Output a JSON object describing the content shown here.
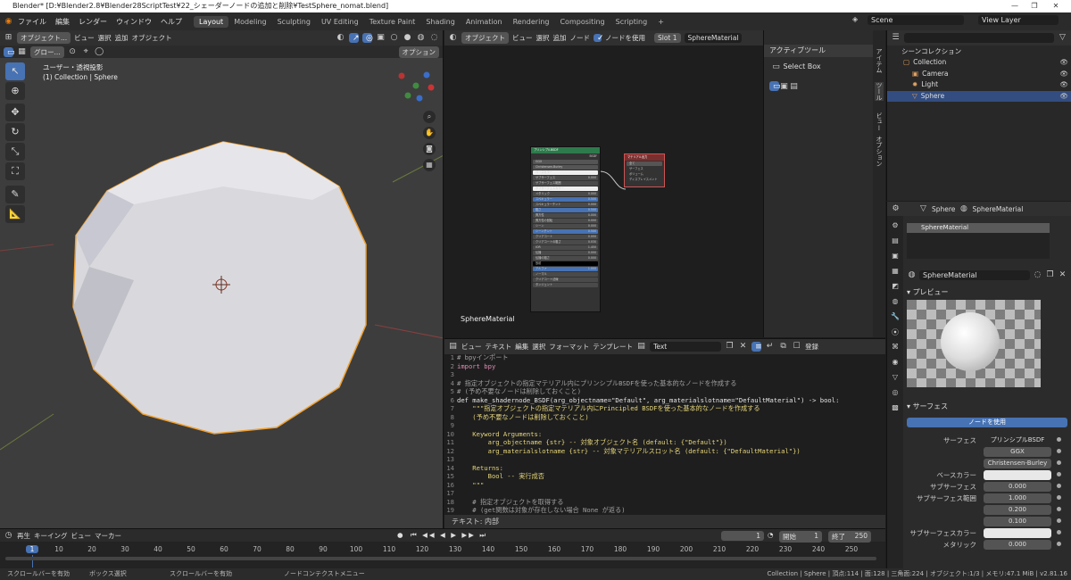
{
  "window": {
    "title": "Blender* [D:¥Blender2.8¥Blender28ScriptTest¥22_シェーダーノードの追加と削除¥TestSphere_nomat.blend]",
    "buttons": [
      "—",
      "❐",
      "✕"
    ]
  },
  "topbar": {
    "menus": [
      "ファイル",
      "編集",
      "レンダー",
      "ウィンドウ",
      "ヘルプ"
    ],
    "workspaces": [
      "Layout",
      "Modeling",
      "Sculpting",
      "UV Editing",
      "Texture Paint",
      "Shading",
      "Animation",
      "Rendering",
      "Compositing",
      "Scripting"
    ],
    "active_workspace": "Layout",
    "add_tab": "+",
    "scene": "Scene",
    "view_layer": "View Layer"
  },
  "viewport": {
    "mode": "オブジェクト...",
    "menus": [
      "ビュー",
      "選択",
      "追加",
      "オブジェクト"
    ],
    "transform": "グロー...",
    "options": "オプション",
    "overlay_line1": "ユーザー・透視投影",
    "overlay_line2": "(1) Collection | Sphere"
  },
  "node_editor": {
    "editor": "オブジェクト",
    "menus": [
      "ビュー",
      "選択",
      "追加",
      "ノード"
    ],
    "use_nodes": "ノードを使用",
    "slot": "Slot 1",
    "material": "SphereMaterial",
    "frame_label": "SphereMaterial",
    "bsdf": {
      "title": "プリンシプルBSDF",
      "out": "BSDF",
      "rows": [
        {
          "l": "GGX",
          "v": "",
          "k": "dd"
        },
        {
          "l": "Christensen-Burley",
          "v": "",
          "k": "dd"
        },
        {
          "l": "ベースカラー",
          "v": "",
          "k": "white"
        },
        {
          "l": "サブサーフェス",
          "v": "0.000",
          "k": ""
        },
        {
          "l": "サブサーフェス範囲",
          "v": "",
          "k": ""
        },
        {
          "l": "サブサーフェスカラー",
          "v": "",
          "k": "white"
        },
        {
          "l": "メタリック",
          "v": "0.000",
          "k": ""
        },
        {
          "l": "スペキュラー",
          "v": "0.500",
          "k": "blue"
        },
        {
          "l": "スペキュラーチント",
          "v": "0.000",
          "k": ""
        },
        {
          "l": "粗さ",
          "v": "0.500",
          "k": "blue"
        },
        {
          "l": "異方性",
          "v": "0.000",
          "k": ""
        },
        {
          "l": "異方性の回転",
          "v": "0.000",
          "k": ""
        },
        {
          "l": "シーン",
          "v": "0.000",
          "k": ""
        },
        {
          "l": "シーンチント",
          "v": "0.500",
          "k": "blue"
        },
        {
          "l": "クリアコート",
          "v": "0.000",
          "k": ""
        },
        {
          "l": "クリアコートの粗さ",
          "v": "0.030",
          "k": ""
        },
        {
          "l": "IOR",
          "v": "1.450",
          "k": ""
        },
        {
          "l": "伝播",
          "v": "0.000",
          "k": ""
        },
        {
          "l": "伝播の粗さ",
          "v": "0.000",
          "k": ""
        },
        {
          "l": "放射",
          "v": "",
          "k": "black"
        },
        {
          "l": "アルファ",
          "v": "1.000",
          "k": "blue"
        },
        {
          "l": "ノーマル",
          "v": "",
          "k": ""
        },
        {
          "l": "クリアコート法線",
          "v": "",
          "k": ""
        },
        {
          "l": "タンジェント",
          "v": "",
          "k": ""
        }
      ]
    },
    "output": {
      "title": "マテリアル出力",
      "dd": "全て",
      "rows": [
        "サーフェス",
        "ボリューム",
        "ディスプレイスメント"
      ]
    }
  },
  "npanel": {
    "title": "アクティブツール",
    "tool": "Select Box",
    "tabs": [
      "アイテム",
      "ツール",
      "ビュー",
      "オプション"
    ]
  },
  "text_editor": {
    "menus": [
      "ビュー",
      "テキスト",
      "編集",
      "選択",
      "フォーマット",
      "テンプレート"
    ],
    "file": "Text",
    "register": "登録",
    "footer": "テキスト: 内部",
    "lines": [
      {
        "n": "1",
        "t": "# bpyインポート",
        "c": "#a0a0a0"
      },
      {
        "n": "2",
        "t": "import bpy",
        "c": "#e08cb4"
      },
      {
        "n": "3",
        "t": "",
        "c": "#ddd"
      },
      {
        "n": "4",
        "t": "# 指定オブジェクトの指定マテリアル内にプリンシプルBSDFを使った基本的なノードを作成する",
        "c": "#a0a0a0"
      },
      {
        "n": "5",
        "t": "# (予め不要なノードは削除しておくこと)",
        "c": "#a0a0a0"
      },
      {
        "n": "6",
        "t": "def make_shadernode_BSDF(arg_objectname=\"Default\", arg_materialslotname=\"DefaultMaterial\") -> bool:",
        "c": "#e6e6e6"
      },
      {
        "n": "7",
        "t": "    \"\"\"指定オブジェクトの指定マテリアル内にPrincipled BSDFを使った基本的なノードを作成する",
        "c": "#e6d67a"
      },
      {
        "n": "8",
        "t": "    (予め不要なノードは削除しておくこと)",
        "c": "#e6d67a"
      },
      {
        "n": "9",
        "t": "",
        "c": "#ddd"
      },
      {
        "n": "10",
        "t": "    Keyword Arguments:",
        "c": "#e6d67a"
      },
      {
        "n": "11",
        "t": "        arg_objectname {str} -- 対象オブジェクト名 (default: {\"Default\"})",
        "c": "#e6d67a"
      },
      {
        "n": "12",
        "t": "        arg_materialslotname {str} -- 対象マテリアルスロット名 (default: {\"DefaultMaterial\"})",
        "c": "#e6d67a"
      },
      {
        "n": "13",
        "t": "",
        "c": "#ddd"
      },
      {
        "n": "14",
        "t": "    Returns:",
        "c": "#e6d67a"
      },
      {
        "n": "15",
        "t": "        Bool -- 実行成否",
        "c": "#e6d67a"
      },
      {
        "n": "16",
        "t": "    \"\"\"",
        "c": "#e6d67a"
      },
      {
        "n": "17",
        "t": "",
        "c": "#ddd"
      },
      {
        "n": "18",
        "t": "    # 指定オブジェクトを取得する",
        "c": "#a0a0a0"
      },
      {
        "n": "19",
        "t": "    # (get関数は対象が存在しない場合 None が返る)",
        "c": "#a0a0a0"
      }
    ]
  },
  "outliner": {
    "title": "シーンコレクション",
    "items": [
      {
        "name": "Collection",
        "indent": 1,
        "sel": false
      },
      {
        "name": "Camera",
        "indent": 2,
        "sel": false
      },
      {
        "name": "Light",
        "indent": 2,
        "sel": false
      },
      {
        "name": "Sphere",
        "indent": 2,
        "sel": true
      }
    ]
  },
  "properties": {
    "object": "Sphere",
    "material": "SphereMaterial",
    "slot_item": "SphereMaterial",
    "datablock": "SphereMaterial",
    "preview_label": "プレビュー",
    "surface_label": "サーフェス",
    "use_nodes": "ノードを使用",
    "rows": [
      {
        "l": "サーフェス",
        "v": "プリンシプルBSDF"
      },
      {
        "l": "",
        "v": "GGX"
      },
      {
        "l": "",
        "v": "Christensen-Burley"
      },
      {
        "l": "ベースカラー",
        "v": ""
      },
      {
        "l": "サブサーフェス",
        "v": "0.000"
      },
      {
        "l": "サブサーフェス範囲",
        "v": "1.000"
      },
      {
        "l": "",
        "v": "0.200"
      },
      {
        "l": "",
        "v": "0.100"
      },
      {
        "l": "サブサーフェスカラー",
        "v": ""
      },
      {
        "l": "メタリック",
        "v": "0.000"
      }
    ]
  },
  "timeline": {
    "menus": [
      "再生",
      "キーイング",
      "ビュー",
      "マーカー"
    ],
    "current": "1",
    "start_label": "開始",
    "start": "1",
    "end_label": "終了",
    "end": "250",
    "ticks": [
      "1",
      "10",
      "20",
      "30",
      "40",
      "50",
      "60",
      "70",
      "80",
      "90",
      "100",
      "110",
      "120",
      "130",
      "140",
      "150",
      "160",
      "170",
      "180",
      "190",
      "200",
      "210",
      "220",
      "230",
      "240",
      "250"
    ]
  },
  "status": {
    "left": [
      "スクロールバーを有効",
      "ボックス選択",
      "スクロールバーを有効",
      "ノードコンテクストメニュー"
    ],
    "right": "Collection | Sphere | 頂点:114 | 面:128 | 三角面:224 | オブジェクト:1/3 | メモリ:47.1 MiB | v2.81.16"
  }
}
